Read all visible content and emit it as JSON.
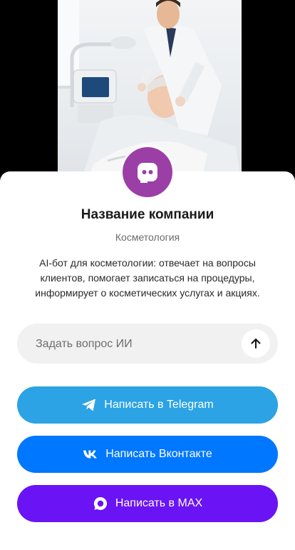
{
  "company": {
    "name": "Название компании",
    "category": "Косметология",
    "description": "AI-бот для косметологии: отвечает на вопросы клиентов, помогает записаться на процедуры, информирует о косметических услугах и акциях."
  },
  "ask": {
    "placeholder": "Задать вопрос ИИ",
    "send_icon": "arrow-up-icon"
  },
  "buttons": [
    {
      "label": "Написать в Telegram",
      "icon": "telegram-icon",
      "color": "#2ba3e4"
    },
    {
      "label": "Написать Вконтакте",
      "icon": "vk-icon",
      "color": "#0077ff"
    },
    {
      "label": "Написать в MAX",
      "icon": "max-icon",
      "color": "#6a13f5"
    }
  ],
  "colors": {
    "avatar": "#9b3fa7",
    "hero_background": "#000000"
  }
}
